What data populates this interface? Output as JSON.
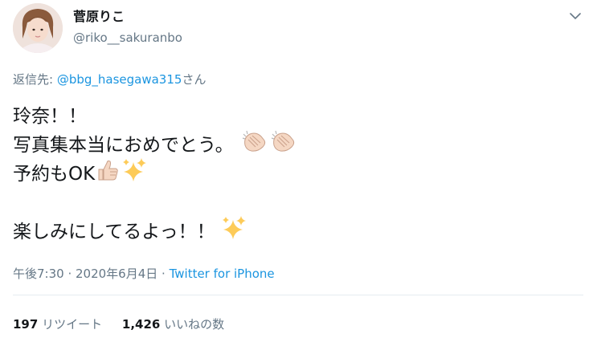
{
  "user": {
    "display_name": "菅原りこ",
    "handle": "@riko__sakuranbo"
  },
  "reply": {
    "prefix": "返信先: ",
    "mention": "@bbg_hasegawa315",
    "suffix": "さん"
  },
  "tweet": {
    "lines": [
      "玲奈！！",
      "写真集本当におめでとう。",
      "予約もOK",
      "",
      "楽しみにしてるよっ！！"
    ],
    "emojis": {
      "line2": [
        "clapping-hands-icon",
        "clapping-hands-icon"
      ],
      "line3": [
        "thumbs-up-icon",
        "sparkles-icon"
      ],
      "line5": [
        "sparkles-icon"
      ]
    }
  },
  "meta": {
    "time": "午後7:30",
    "separator": " · ",
    "date": "2020年6月4日",
    "source": "Twitter for iPhone"
  },
  "stats": {
    "retweets_count": "197",
    "retweets_label": "リツイート",
    "likes_count": "1,426",
    "likes_label": "いいねの数"
  },
  "colors": {
    "link": "#1b95e0",
    "secondary": "#657786",
    "primary": "#14171a",
    "divider": "#e6ecf0"
  }
}
